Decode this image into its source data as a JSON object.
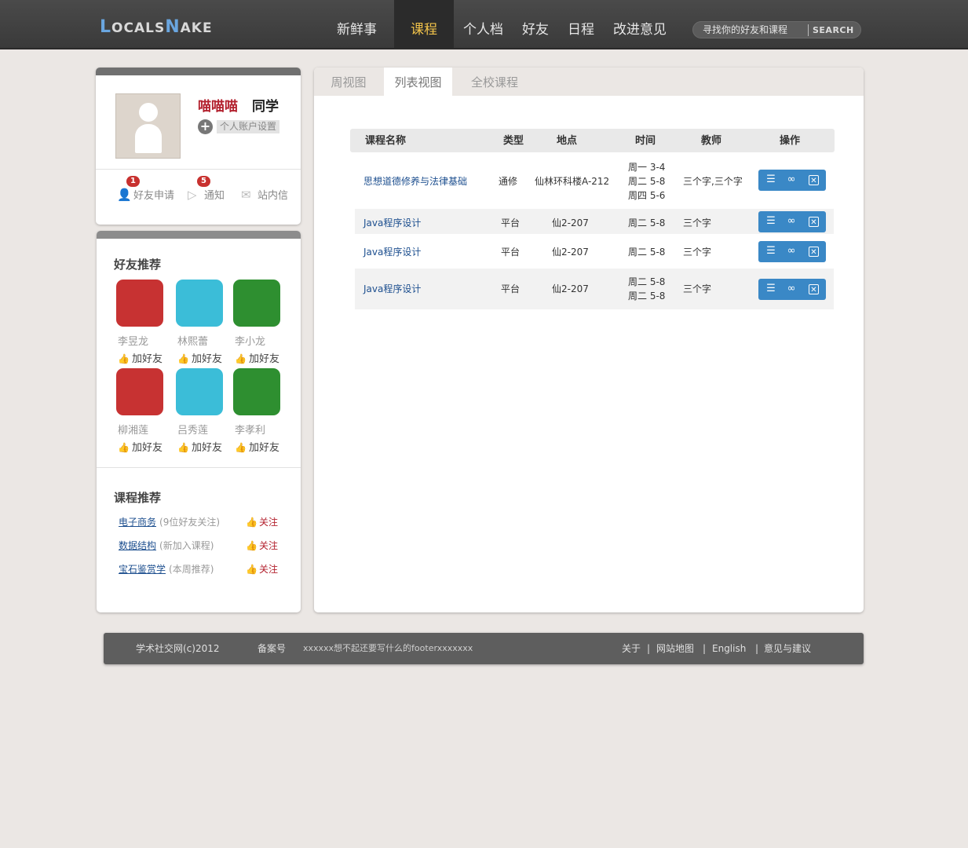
{
  "header": {
    "logo_text": "LOCALSNAKE",
    "logo_parts": [
      "L",
      "OCALS",
      "N",
      "AKE"
    ],
    "nav": [
      "新鲜事",
      "课程",
      "个人档",
      "好友",
      "日程",
      "改进意见"
    ],
    "active_nav": "课程",
    "search_placeholder": "寻找你的好友和课程",
    "search_button": "SEARCH"
  },
  "profile": {
    "name": "喵喵喵",
    "title": "同学",
    "settings_label": "个人账户设置",
    "stats": [
      {
        "label": "好友申请",
        "badge": "1",
        "icon": "user-add-icon"
      },
      {
        "label": "通知",
        "badge": "5",
        "icon": "notification-icon"
      },
      {
        "label": "站内信",
        "badge": "",
        "icon": "mail-icon"
      }
    ]
  },
  "friend_recommend": {
    "title": "好友推荐",
    "add_label": "加好友",
    "friends": [
      {
        "name": "李昱龙",
        "color": "#c73232"
      },
      {
        "name": "林熙蕾",
        "color": "#3bbdd8"
      },
      {
        "name": "李小龙",
        "color": "#2e8f30"
      },
      {
        "name": "柳湘莲",
        "color": "#c73232"
      },
      {
        "name": "吕秀莲",
        "color": "#3bbdd8"
      },
      {
        "name": "李孝利",
        "color": "#2e8f30"
      }
    ]
  },
  "course_recommend": {
    "title": "课程推荐",
    "follow_label": "关注",
    "items": [
      {
        "name": "电子商务",
        "note": "(9位好友关注)"
      },
      {
        "name": "数据结构",
        "note": "(新加入课程)"
      },
      {
        "name": "宝石鉴赏学",
        "note": "(本周推荐)"
      }
    ]
  },
  "main": {
    "tabs": [
      "周视图",
      "列表视图",
      "全校课程"
    ],
    "active_tab": "列表视图",
    "columns": [
      "课程名称",
      "类型",
      "地点",
      "时间",
      "教师",
      "操作"
    ],
    "rows": [
      {
        "name": "思想道德修养与法律基础",
        "type": "通修",
        "location": "仙林环科楼A-212",
        "times": [
          "周一 3-4",
          "周二 5-8",
          "周四 5-6"
        ],
        "teacher": "三个字,三个字"
      },
      {
        "name": "Java程序设计",
        "type": "平台",
        "location": "仙2-207",
        "times": [
          "周二 5-8"
        ],
        "teacher": "三个字"
      },
      {
        "name": "Java程序设计",
        "type": "平台",
        "location": "仙2-207",
        "times": [
          "周二 5-8"
        ],
        "teacher": "三个字"
      },
      {
        "name": "Java程序设计",
        "type": "平台",
        "location": "仙2-207",
        "times": [
          "周二 5-8",
          "周二 5-8"
        ],
        "teacher": "三个字"
      }
    ],
    "op_icons": [
      "comment-icon",
      "glasses-icon",
      "delete-icon"
    ]
  },
  "footer": {
    "copyright": "学术社交网(c)2012",
    "icp": "备案号",
    "text": "xxxxxx想不起还要写什么的footerxxxxxxx",
    "links": [
      "关于",
      "网站地图",
      "English",
      "意见与建议"
    ]
  },
  "colors": {
    "accent": "#3a88c6",
    "nav_active": "#f0c24a",
    "name_red": "#b3212e",
    "badge": "#c8312f"
  }
}
